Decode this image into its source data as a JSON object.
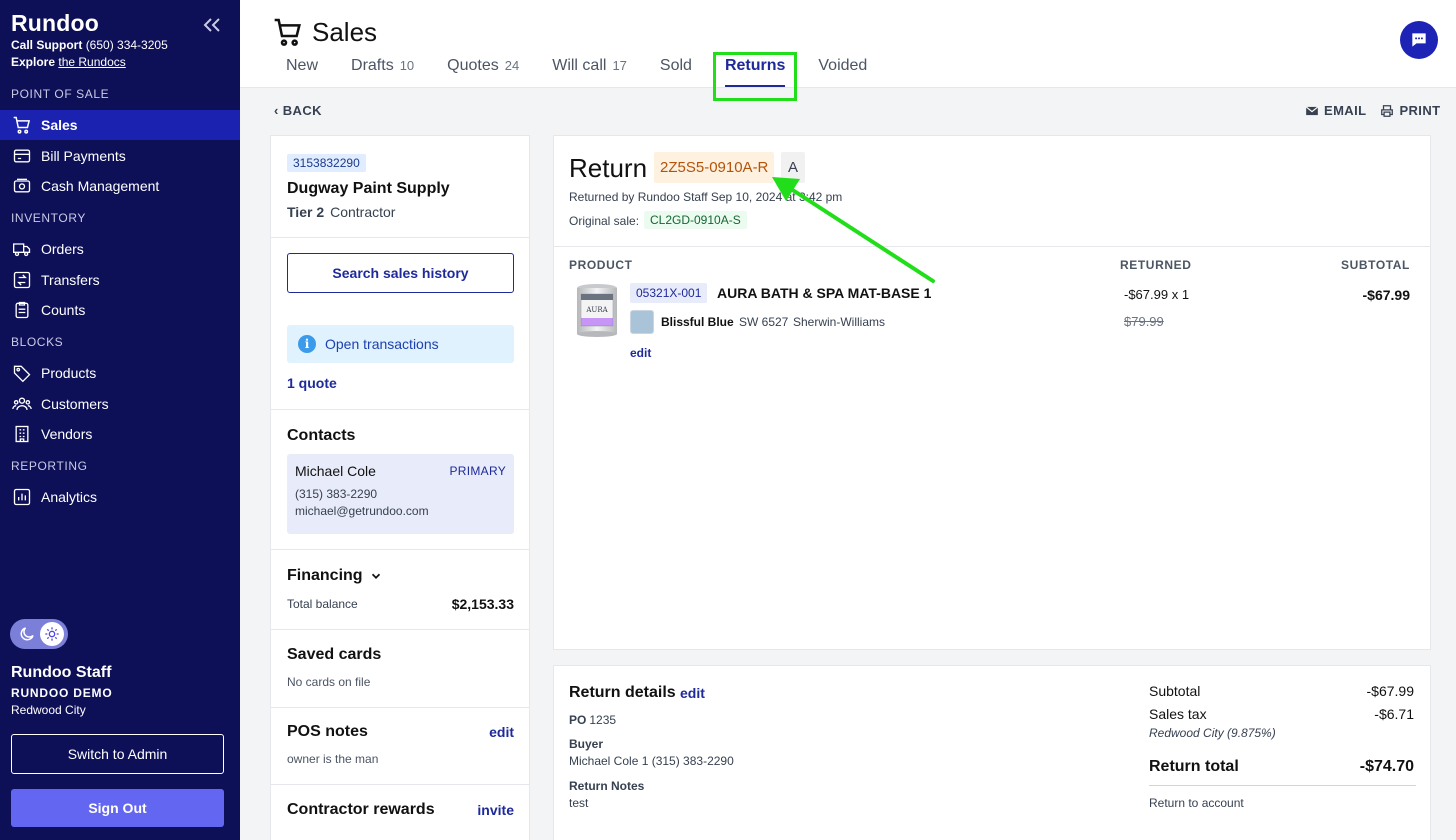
{
  "sidebar": {
    "brand": "Rundoo",
    "support_label": "Call Support",
    "support_phone": "(650) 334-3205",
    "explore_label": "Explore",
    "explore_link": "the Rundocs",
    "sections": {
      "pos": "POINT OF SALE",
      "inventory": "INVENTORY",
      "blocks": "BLOCKS",
      "reporting": "REPORTING"
    },
    "items": {
      "sales": "Sales",
      "bill_payments": "Bill Payments",
      "cash_management": "Cash Management",
      "orders": "Orders",
      "transfers": "Transfers",
      "counts": "Counts",
      "products": "Products",
      "customers": "Customers",
      "vendors": "Vendors",
      "analytics": "Analytics"
    },
    "user": {
      "name": "Rundoo Staff",
      "org": "RUNDOO DEMO",
      "location": "Redwood City"
    },
    "switch_label": "Switch to Admin",
    "signout_label": "Sign Out"
  },
  "header": {
    "title": "Sales",
    "tabs": [
      {
        "label": "New",
        "count": ""
      },
      {
        "label": "Drafts",
        "count": "10"
      },
      {
        "label": "Quotes",
        "count": "24"
      },
      {
        "label": "Will call",
        "count": "17"
      },
      {
        "label": "Sold",
        "count": ""
      },
      {
        "label": "Returns",
        "count": ""
      },
      {
        "label": "Voided",
        "count": ""
      }
    ],
    "active_tab": "Returns"
  },
  "subheader": {
    "back": "BACK",
    "email": "EMAIL",
    "print": "PRINT"
  },
  "customer": {
    "id": "3153832290",
    "name": "Dugway Paint Supply",
    "tier": "Tier 2",
    "type": "Contractor",
    "search_button": "Search sales history",
    "open_transactions": "Open transactions",
    "quote_link": "1 quote",
    "contacts_title": "Contacts",
    "contact": {
      "name": "Michael Cole",
      "badge": "PRIMARY",
      "phone": "(315) 383-2290",
      "email": "michael@getrundoo.com"
    },
    "financing_title": "Financing",
    "total_balance_label": "Total balance",
    "total_balance": "$2,153.33",
    "saved_cards_title": "Saved cards",
    "saved_cards_text": "No cards on file",
    "pos_notes_title": "POS notes",
    "pos_notes_edit": "edit",
    "pos_notes_text": "owner is the man",
    "rewards_title": "Contractor rewards",
    "rewards_link": "invite"
  },
  "return": {
    "title": "Return",
    "id": "2Z5S5-0910A-R",
    "grade": "A",
    "returned_by": "Returned by Rundoo Staff Sep 10, 2024 at 3:42 pm",
    "original_label": "Original sale:",
    "original_id": "CL2GD-0910A-S",
    "columns": {
      "product": "PRODUCT",
      "returned": "RETURNED",
      "subtotal": "SUBTOTAL"
    },
    "line": {
      "sku": "05321X-001",
      "name": "AURA BATH & SPA MAT-BASE 1",
      "color_name": "Blissful Blue",
      "color_code": "SW 6527",
      "color_brand": "Sherwin-Williams",
      "edit": "edit",
      "qty": "-$67.99 x 1",
      "original_price": "$79.99",
      "subtotal": "-$67.99"
    }
  },
  "details": {
    "title": "Return details",
    "edit": "edit",
    "po_label": "PO",
    "po_value": "1235",
    "buyer_label": "Buyer",
    "buyer_value": "Michael Cole 1 (315) 383-2290",
    "notes_label": "Return Notes",
    "notes_value": "test"
  },
  "totals": {
    "subtotal_label": "Subtotal",
    "subtotal": "-$67.99",
    "tax_label": "Sales tax",
    "tax": "-$6.71",
    "tax_region": "Redwood City (9.875%)",
    "total_label": "Return total",
    "total": "-$74.70",
    "refund_method": "Return to account"
  },
  "colors": {
    "sidebar_bg": "#0d0f57",
    "accent": "#1e2a9a",
    "highlight_box": "#22dd1a",
    "return_id_bg": "#fff1e0"
  }
}
